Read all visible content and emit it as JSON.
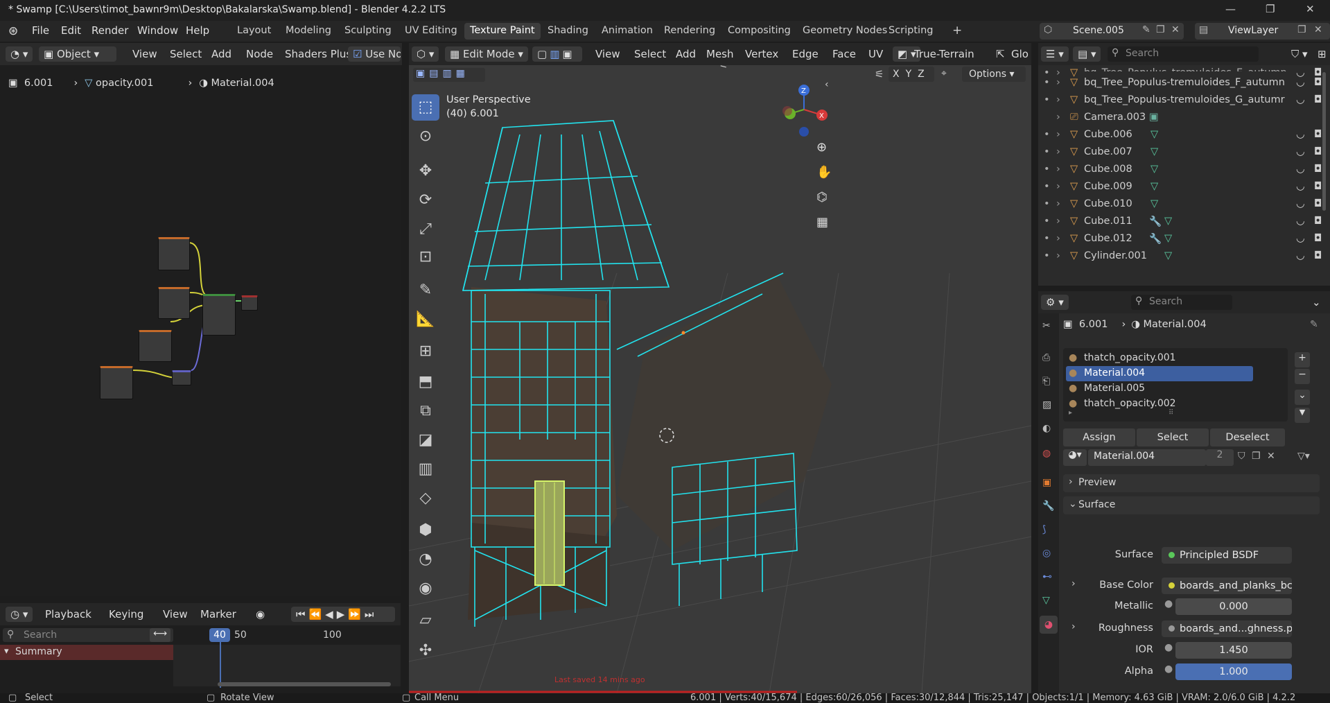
{
  "window": {
    "title": "* Swamp [C:\\Users\\timot_bawnr9m\\Desktop\\Bakalarska\\Swamp.blend] - Blender 4.2.2 LTS"
  },
  "menu": [
    "File",
    "Edit",
    "Render",
    "Window",
    "Help"
  ],
  "workspaces": [
    "Layout",
    "Modeling",
    "Sculpting",
    "UV Editing",
    "Texture Paint",
    "Shading",
    "Animation",
    "Rendering",
    "Compositing",
    "Geometry Nodes",
    "Scripting"
  ],
  "scene": {
    "name": "Scene.005",
    "view_layer": "ViewLayer"
  },
  "node_editor": {
    "mode": "Object",
    "menus": [
      "View",
      "Select",
      "Add",
      "Node",
      "Shaders Plus"
    ],
    "use_nodes_label": "Use Nod",
    "breadcrumbs": [
      "6.001",
      "opacity.001",
      "Material.004"
    ]
  },
  "timeline": {
    "menus": [
      "Playback",
      "Keying",
      "View",
      "Marker"
    ],
    "search_placeholder": "Search",
    "current_frame": "40",
    "ticks": [
      "50",
      "100"
    ],
    "summary": "Summary"
  },
  "viewport": {
    "mode": "Edit Mode",
    "menus": [
      "View",
      "Select",
      "Add",
      "Mesh",
      "Vertex",
      "Edge",
      "Face",
      "UV"
    ],
    "terrain": "True-Terrain",
    "glo": "Glo",
    "axes": [
      "X",
      "Y",
      "Z"
    ],
    "options": "Options",
    "perspective": "User Perspective",
    "object_info": "(40) 6.001",
    "last_saved": "Last saved 14 mins ago",
    "gizmo": {
      "z": "Z",
      "x": "X"
    }
  },
  "outliner": {
    "search_placeholder": "Search",
    "rows": [
      "bq_Tree_Populus_tremuloides_E_autumn",
      "bq_Tree_Populus-tremuloides_F_autumn",
      "bq_Tree_Populus-tremuloides_G_autumr",
      "Camera.003",
      "Cube.006",
      "Cube.007",
      "Cube.008",
      "Cube.009",
      "Cube.010",
      "Cube.011",
      "Cube.012",
      "Cylinder.001"
    ]
  },
  "properties": {
    "search_placeholder": "Search",
    "breadcrumbs": [
      "6.001",
      "Material.004"
    ],
    "slots": [
      "thatch_opacity.001",
      "Material.004",
      "Material.005",
      "thatch_opacity.002"
    ],
    "selected_slot": 1,
    "buttons": {
      "assign": "Assign",
      "select": "Select",
      "deselect": "Deselect"
    },
    "material_name": "Material.004",
    "users": "2",
    "panels": {
      "preview": "Preview",
      "surface": "Surface"
    },
    "fields": [
      {
        "label": "Surface",
        "value": "Principled BSDF"
      },
      {
        "label": "Base Color",
        "value": "boards_and_planks_bc...."
      },
      {
        "label": "Metallic",
        "value": "0.000"
      },
      {
        "label": "Roughness",
        "value": "boards_and...ghness.png"
      },
      {
        "label": "IOR",
        "value": "1.450"
      },
      {
        "label": "Alpha",
        "value": "1.000"
      }
    ]
  },
  "status": {
    "left": [
      "Select",
      "Rotate View",
      "Call Menu"
    ],
    "stats": "6.001 | Verts:40/15,674 | Edges:60/26,056 | Faces:30/12,844 | Tris:25,147 | Objects:1/1 | Memory: 4.63 GiB | VRAM: 2.0/6.0 GiB | 4.2.2"
  },
  "colors": {
    "accent": "#4a6fb3",
    "wire": "#22e3ee",
    "selected": "#d6f56a"
  }
}
